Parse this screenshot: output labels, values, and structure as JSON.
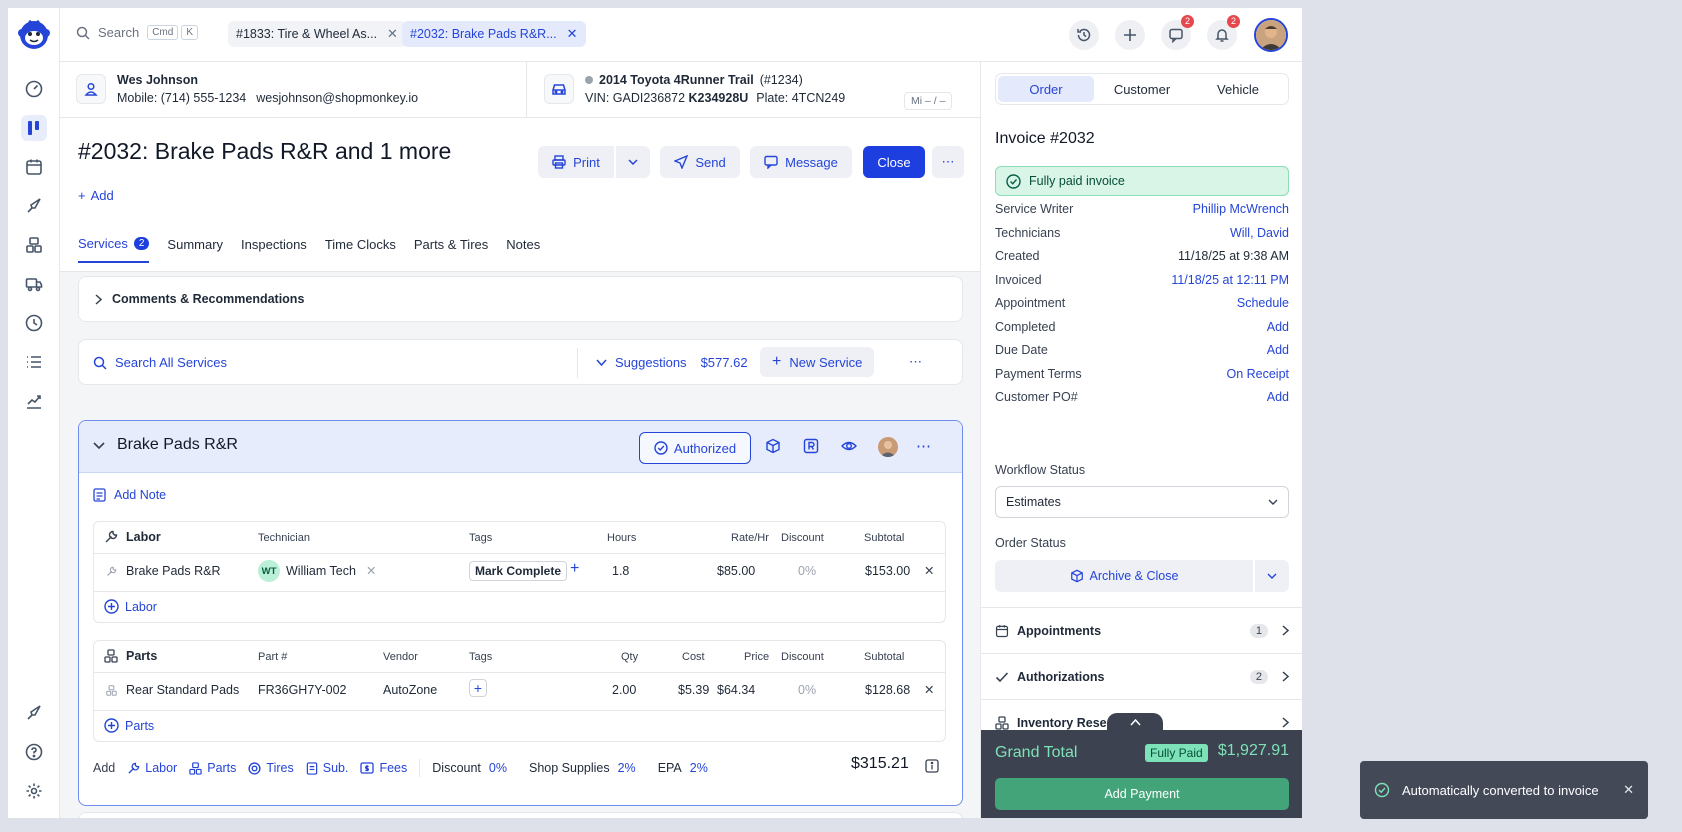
{
  "topbar": {
    "search_label": "Search",
    "kbd_cmd": "Cmd",
    "kbd_k": "K",
    "tabs": [
      {
        "label": "#1833: Tire & Wheel As..."
      },
      {
        "label": "#2032: Brake Pads R&R..."
      }
    ],
    "chat_badge": "2",
    "notif_badge": "2"
  },
  "customer": {
    "name": "Wes Johnson",
    "mobile": "Mobile: (714) 555-1234",
    "email": "wesjohnson@shopmonkey.io"
  },
  "vehicle": {
    "name": "2014 Toyota 4Runner Trail",
    "number": "(#1234)",
    "vin_label": "VIN: GADI236872 ",
    "vin_bold": "K234928U",
    "plate": "Plate: 4TCN249",
    "mileage": "Mi  – / –"
  },
  "order": {
    "title": "#2032: Brake Pads R&R and 1 more",
    "add_label": "Add",
    "print": "Print",
    "send": "Send",
    "message": "Message",
    "close": "Close"
  },
  "tabs": [
    {
      "label": "Services",
      "count": "2"
    },
    {
      "label": "Summary"
    },
    {
      "label": "Inspections"
    },
    {
      "label": "Time Clocks"
    },
    {
      "label": "Parts & Tires"
    },
    {
      "label": "Notes"
    }
  ],
  "comments": {
    "label": "Comments & Recommendations"
  },
  "service_search": {
    "placeholder": "Search All Services",
    "suggestions": "Suggestions",
    "suggestions_amount": "$577.62",
    "new_service": "New Service"
  },
  "service": {
    "title": "Brake Pads R&R",
    "authorized": "Authorized",
    "add_note": "Add Note",
    "labor": {
      "headers": [
        "Labor",
        "Technician",
        "Tags",
        "Hours",
        "Rate/Hr",
        "Discount",
        "Subtotal"
      ],
      "row": {
        "name": "Brake Pads R&R",
        "tech_initials": "WT",
        "tech": "William Tech",
        "tag": "Mark Complete",
        "hours": "1.8",
        "rate": "$85.00",
        "discount": "0%",
        "subtotal": "$153.00"
      },
      "add": "Labor"
    },
    "parts": {
      "headers": [
        "Parts",
        "Part #",
        "Vendor",
        "Tags",
        "Qty",
        "Cost",
        "Price",
        "Discount",
        "Subtotal"
      ],
      "row": {
        "name": "Rear Standard Pads",
        "part_no": "FR36GH7Y-002",
        "vendor": "AutoZone",
        "qty": "2.00",
        "cost": "$5.39",
        "price": "$64.34",
        "discount": "0%",
        "subtotal": "$128.68"
      },
      "add": "Parts"
    },
    "footer": {
      "add": "Add",
      "labor": "Labor",
      "parts": "Parts",
      "tires": "Tires",
      "sub": "Sub.",
      "fees": "Fees",
      "discount_label": "Discount",
      "discount": "0%",
      "shop_supplies_label": "Shop Supplies",
      "shop_supplies": "2%",
      "epa_label": "EPA",
      "epa": "2%",
      "total": "$315.21"
    }
  },
  "panel": {
    "segments": [
      "Order",
      "Customer",
      "Vehicle"
    ],
    "invoice_title": "Invoice #2032",
    "paid_label": "Fully paid invoice",
    "fields": [
      {
        "k": "Service Writer",
        "v": "Phillip McWrench",
        "link": true
      },
      {
        "k": "Technicians",
        "v": "Will, David",
        "link": true
      },
      {
        "k": "Created",
        "v": "11/18/25 at 9:38 AM",
        "link": false
      },
      {
        "k": "Invoiced",
        "v": "11/18/25 at 12:11 PM",
        "link": true
      },
      {
        "k": "Appointment",
        "v": "Schedule",
        "link": true
      },
      {
        "k": "Completed",
        "v": "Add",
        "link": true
      },
      {
        "k": "Due Date",
        "v": "Add",
        "link": true
      },
      {
        "k": "Payment Terms",
        "v": "On Receipt",
        "link": true
      },
      {
        "k": "Customer PO#",
        "v": "Add",
        "link": true
      }
    ],
    "workflow_label": "Workflow Status",
    "workflow_value": "Estimates",
    "order_status_label": "Order Status",
    "archive_label": "Archive & Close",
    "accordions": [
      {
        "label": "Appointments",
        "count": "1"
      },
      {
        "label": "Authorizations",
        "count": "2"
      },
      {
        "label": "Inventory Reserv"
      }
    ],
    "grand_total_label": "Grand Total",
    "fully_paid": "Fully Paid",
    "grand_total": "$1,927.91",
    "add_payment": "Add Payment"
  },
  "toast": {
    "message": "Automatically converted to invoice"
  }
}
